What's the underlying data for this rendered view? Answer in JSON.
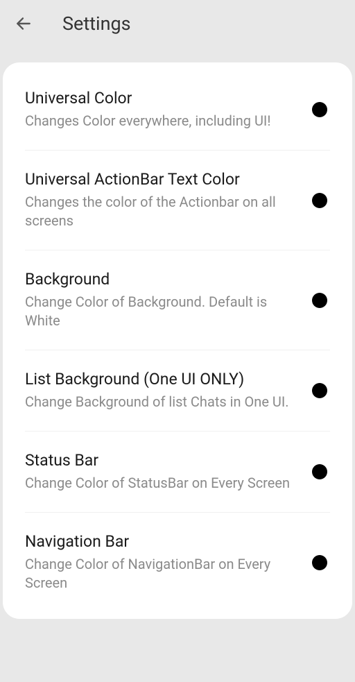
{
  "header": {
    "title": "Settings"
  },
  "settings": [
    {
      "title": "Universal Color",
      "desc": "Changes Color everywhere, including UI!",
      "color": "#000000"
    },
    {
      "title": "Universal ActionBar Text Color",
      "desc": "Changes the color of the Actionbar on all screens",
      "color": "#000000"
    },
    {
      "title": "Background",
      "desc": "Change Color of Background. Default is White",
      "color": "#000000"
    },
    {
      "title": "List Background (One UI ONLY)",
      "desc": "Change Background of list Chats in One UI.",
      "color": "#000000"
    },
    {
      "title": "Status Bar",
      "desc": "Change Color of StatusBar on Every Screen",
      "color": "#000000"
    },
    {
      "title": "Navigation Bar",
      "desc": "Change Color of NavigationBar on Every Screen",
      "color": "#000000"
    }
  ]
}
